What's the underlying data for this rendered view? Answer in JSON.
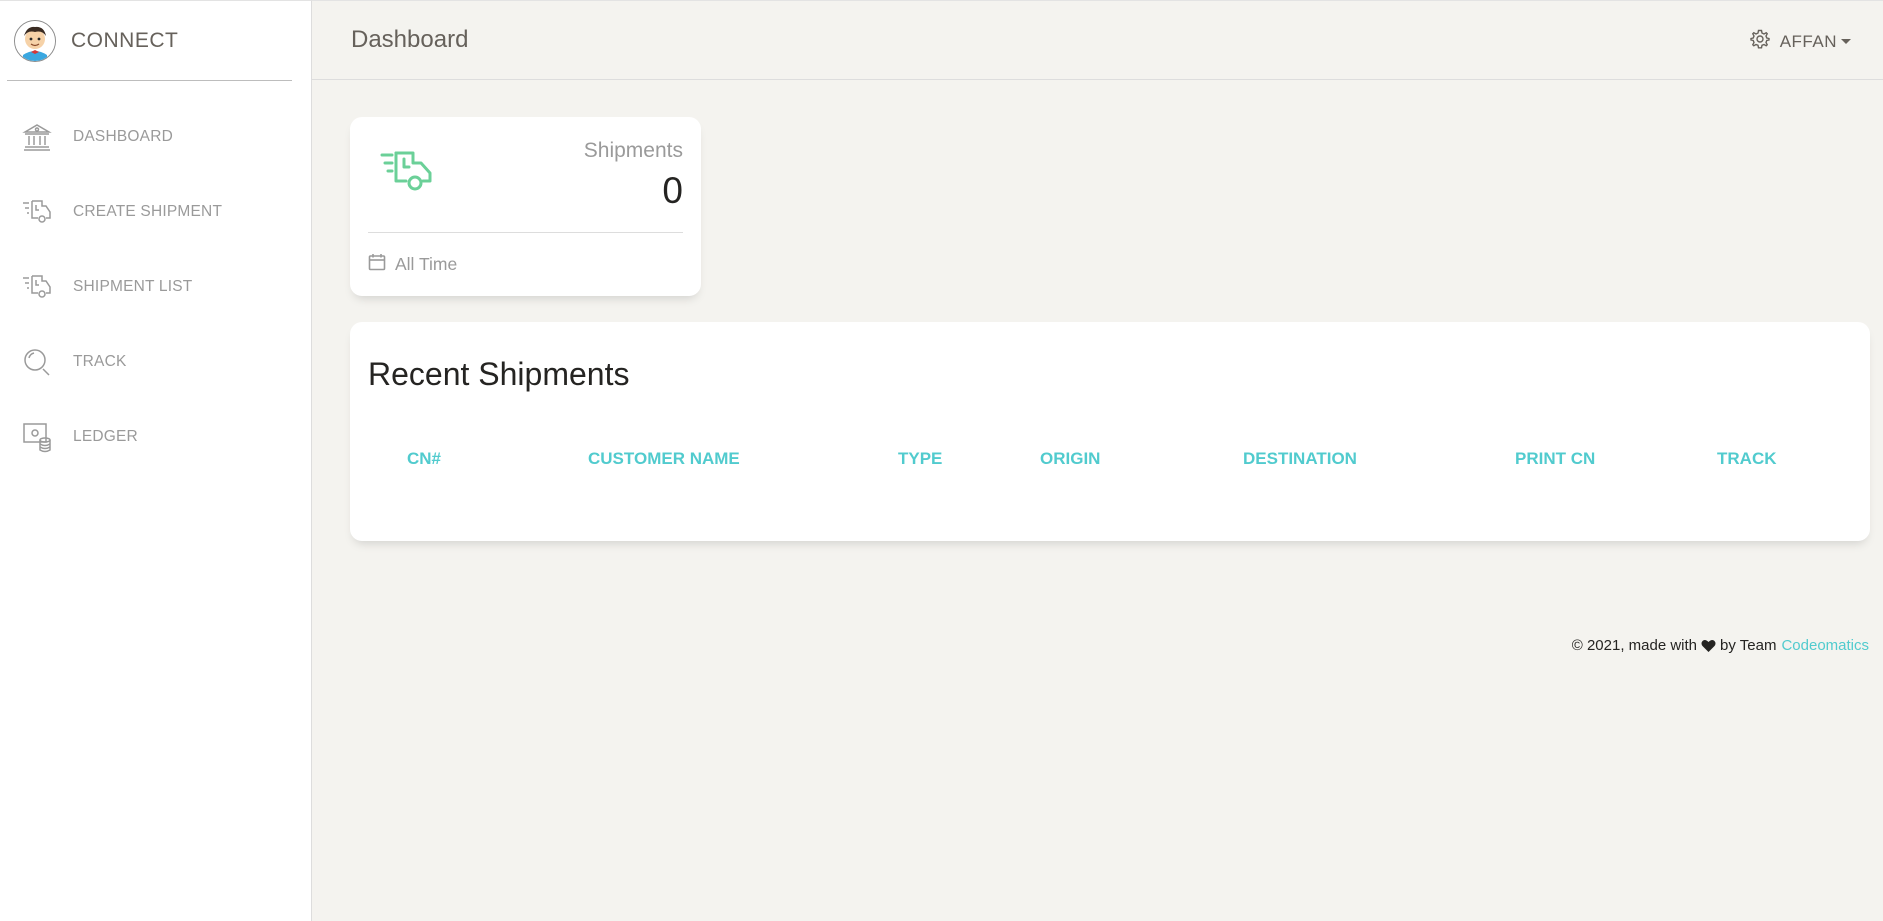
{
  "brand": {
    "name": "CONNECT",
    "logo_icon": "cartoon-avatar-logo"
  },
  "sidebar": {
    "items": [
      {
        "label": "DASHBOARD",
        "icon": "bank-icon"
      },
      {
        "label": "CREATE SHIPMENT",
        "icon": "delivery-truck-icon"
      },
      {
        "label": "SHIPMENT LIST",
        "icon": "delivery-truck-icon"
      },
      {
        "label": "TRACK",
        "icon": "search-icon"
      },
      {
        "label": "LEDGER",
        "icon": "money-coins-icon"
      }
    ]
  },
  "header": {
    "title": "Dashboard",
    "user": {
      "name": "AFFAN",
      "icon": "gear-icon"
    }
  },
  "stats": {
    "shipments": {
      "label": "Shipments",
      "value": "0",
      "footer": "All Time",
      "icon": "delivery-truck-icon",
      "footer_icon": "calendar-icon",
      "icon_color": "#6bd098"
    }
  },
  "recent": {
    "title": "Recent Shipments",
    "columns": [
      "CN#",
      "CUSTOMER NAME",
      "TYPE",
      "ORIGIN",
      "DESTINATION",
      "PRINT CN",
      "TRACK"
    ],
    "rows": []
  },
  "footer": {
    "prefix": "© 2021, made with",
    "suffix": "by Team",
    "link": "Codeomatics"
  },
  "colors": {
    "accent": "#51cbce",
    "success": "#6bd098",
    "background": "#f4f3ef",
    "muted_text": "#9a9a9a"
  }
}
